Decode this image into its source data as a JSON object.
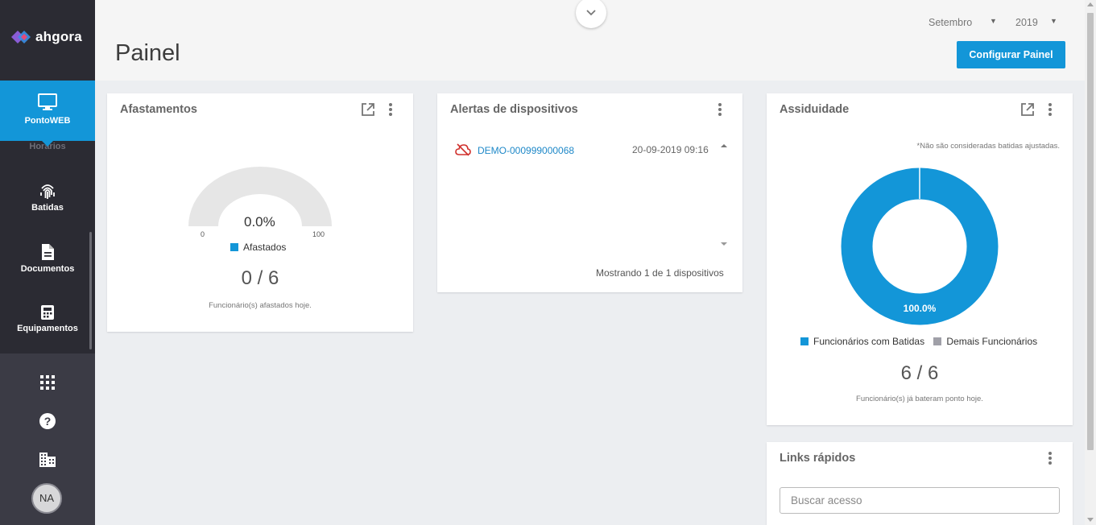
{
  "sidebar": {
    "logo_text": "ahgora",
    "active_item": "PontoWEB",
    "hidden_item": "Horários",
    "items": [
      {
        "label": "Batidas",
        "icon": "fingerprint-icon"
      },
      {
        "label": "Documentos",
        "icon": "document-icon"
      },
      {
        "label": "Equipamentos",
        "icon": "device-icon"
      }
    ],
    "bottom_icons": [
      "apps-grid-icon",
      "help-icon",
      "building-icon"
    ],
    "avatar_initials": "NA"
  },
  "header": {
    "title": "Painel",
    "month": "Setembro",
    "year": "2019",
    "config_button": "Configurar Painel"
  },
  "afastamentos": {
    "title": "Afastamentos",
    "gauge_value": "0.0%",
    "gauge_fraction": 0.0,
    "gauge_min": "0",
    "gauge_max": "100",
    "legend": "Afastados",
    "count": "0 / 6",
    "note": "Funcionário(s) afastados hoje."
  },
  "alertas": {
    "title": "Alertas de dispositivos",
    "device": "DEMO-000999000068",
    "datetime": "20-09-2019 09:16",
    "footer": "Mostrando 1 de 1 dispositivos"
  },
  "assiduidade": {
    "title": "Assiduidade",
    "note_top": "*Não são consideradas batidas ajustadas.",
    "donut_label": "100.0%",
    "legend_with": "Funcionários com Batidas",
    "legend_other": "Demais Funcionários",
    "count": "6 / 6",
    "note": "Funcionário(s) já bateram ponto hoje."
  },
  "links": {
    "title": "Links rápidos",
    "search_placeholder": "Buscar acesso"
  },
  "chart_data": [
    {
      "type": "pie",
      "title": "Afastamentos",
      "categories": [
        "Afastados"
      ],
      "values": [
        0.0
      ],
      "ylim": [
        0,
        100
      ]
    },
    {
      "type": "pie",
      "title": "Assiduidade",
      "categories": [
        "Funcionários com Batidas",
        "Demais Funcionários"
      ],
      "values": [
        100.0,
        0.0
      ]
    }
  ],
  "colors": {
    "accent": "#1396d8",
    "sidebar_dark": "#2b2b33",
    "sidebar": "#3b3b45",
    "alert_red": "#d0312d",
    "legend_gray": "#a0a0a8"
  }
}
